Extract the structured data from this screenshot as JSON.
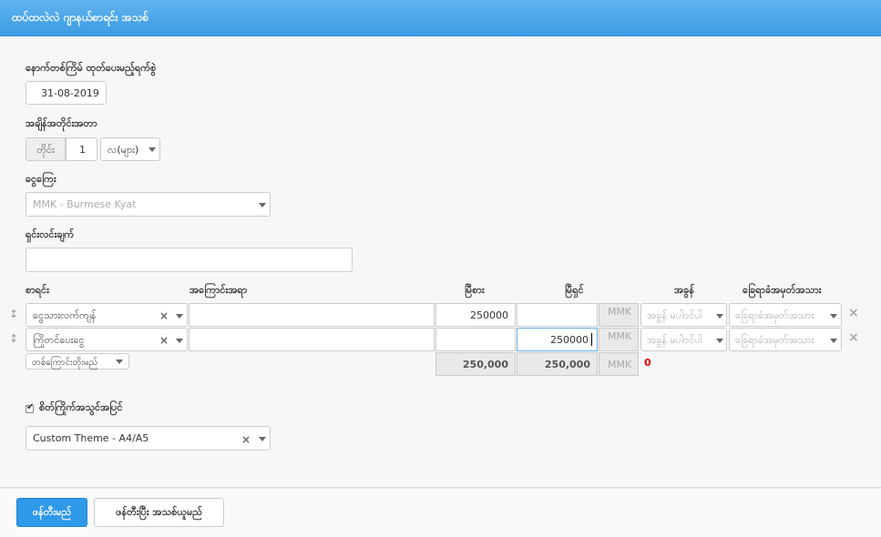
{
  "header": {
    "title": "ထပ်ထလဲလဲ ဂျာနယ်စာရင်း အသစ်"
  },
  "form": {
    "next_date_label": "နောက်တစ်ကြိမ် ထုတ်ပေးမည့်ရက်စွဲ",
    "next_date_value": "31-08-2019",
    "interval_label": "အချိန်အတိုင်းအတာ",
    "interval_prefix": "တိုင်း",
    "interval_value": "1",
    "interval_unit": "လ(များ)",
    "currency_label": "ငွေကြေး",
    "currency_value": "MMK - Burmese Kyat",
    "description_label": "ရှင်းလင်းချက်",
    "description_value": ""
  },
  "table": {
    "headers": {
      "account": "စာရင်း",
      "detail": "အကြောင်းအရာ",
      "debit": "မြီစား",
      "credit": "မြီရှင်",
      "tax": "အခွန်",
      "tag": "ခြေရာခံအမှတ်အသား"
    },
    "rows": [
      {
        "account": "ငွေသားလက်ကျန်",
        "detail": "",
        "debit": "250000",
        "credit": "",
        "currency": "MMK",
        "tax_placeholder": "အခွန် မပါဝင်ပါ",
        "tag_placeholder": "ခြေရာခံအမှတ်အသား"
      },
      {
        "account": "ကြိုတင်ပေးငွေ",
        "detail": "",
        "debit": "",
        "credit": "250000",
        "currency": "MMK",
        "tax_placeholder": "အခွန် မပါဝင်ပါ",
        "tag_placeholder": "ခြေရာခံအမှတ်အသား"
      }
    ],
    "add_line_label": "တစ်ကြောင်းတိုးမည်",
    "total_debit": "250,000",
    "total_credit": "250,000",
    "total_currency": "MMK",
    "difference": "0"
  },
  "options": {
    "notify_label": "စိတ်ကြိုက်အသွင်အပြင်",
    "notify_checked": true,
    "theme_value": "Custom Theme - A4/A5"
  },
  "footer": {
    "save_label": "ဖန်တီးမည်",
    "save_new_label": "ဖန်တီးပြီး အသစ်ယူမည်"
  }
}
